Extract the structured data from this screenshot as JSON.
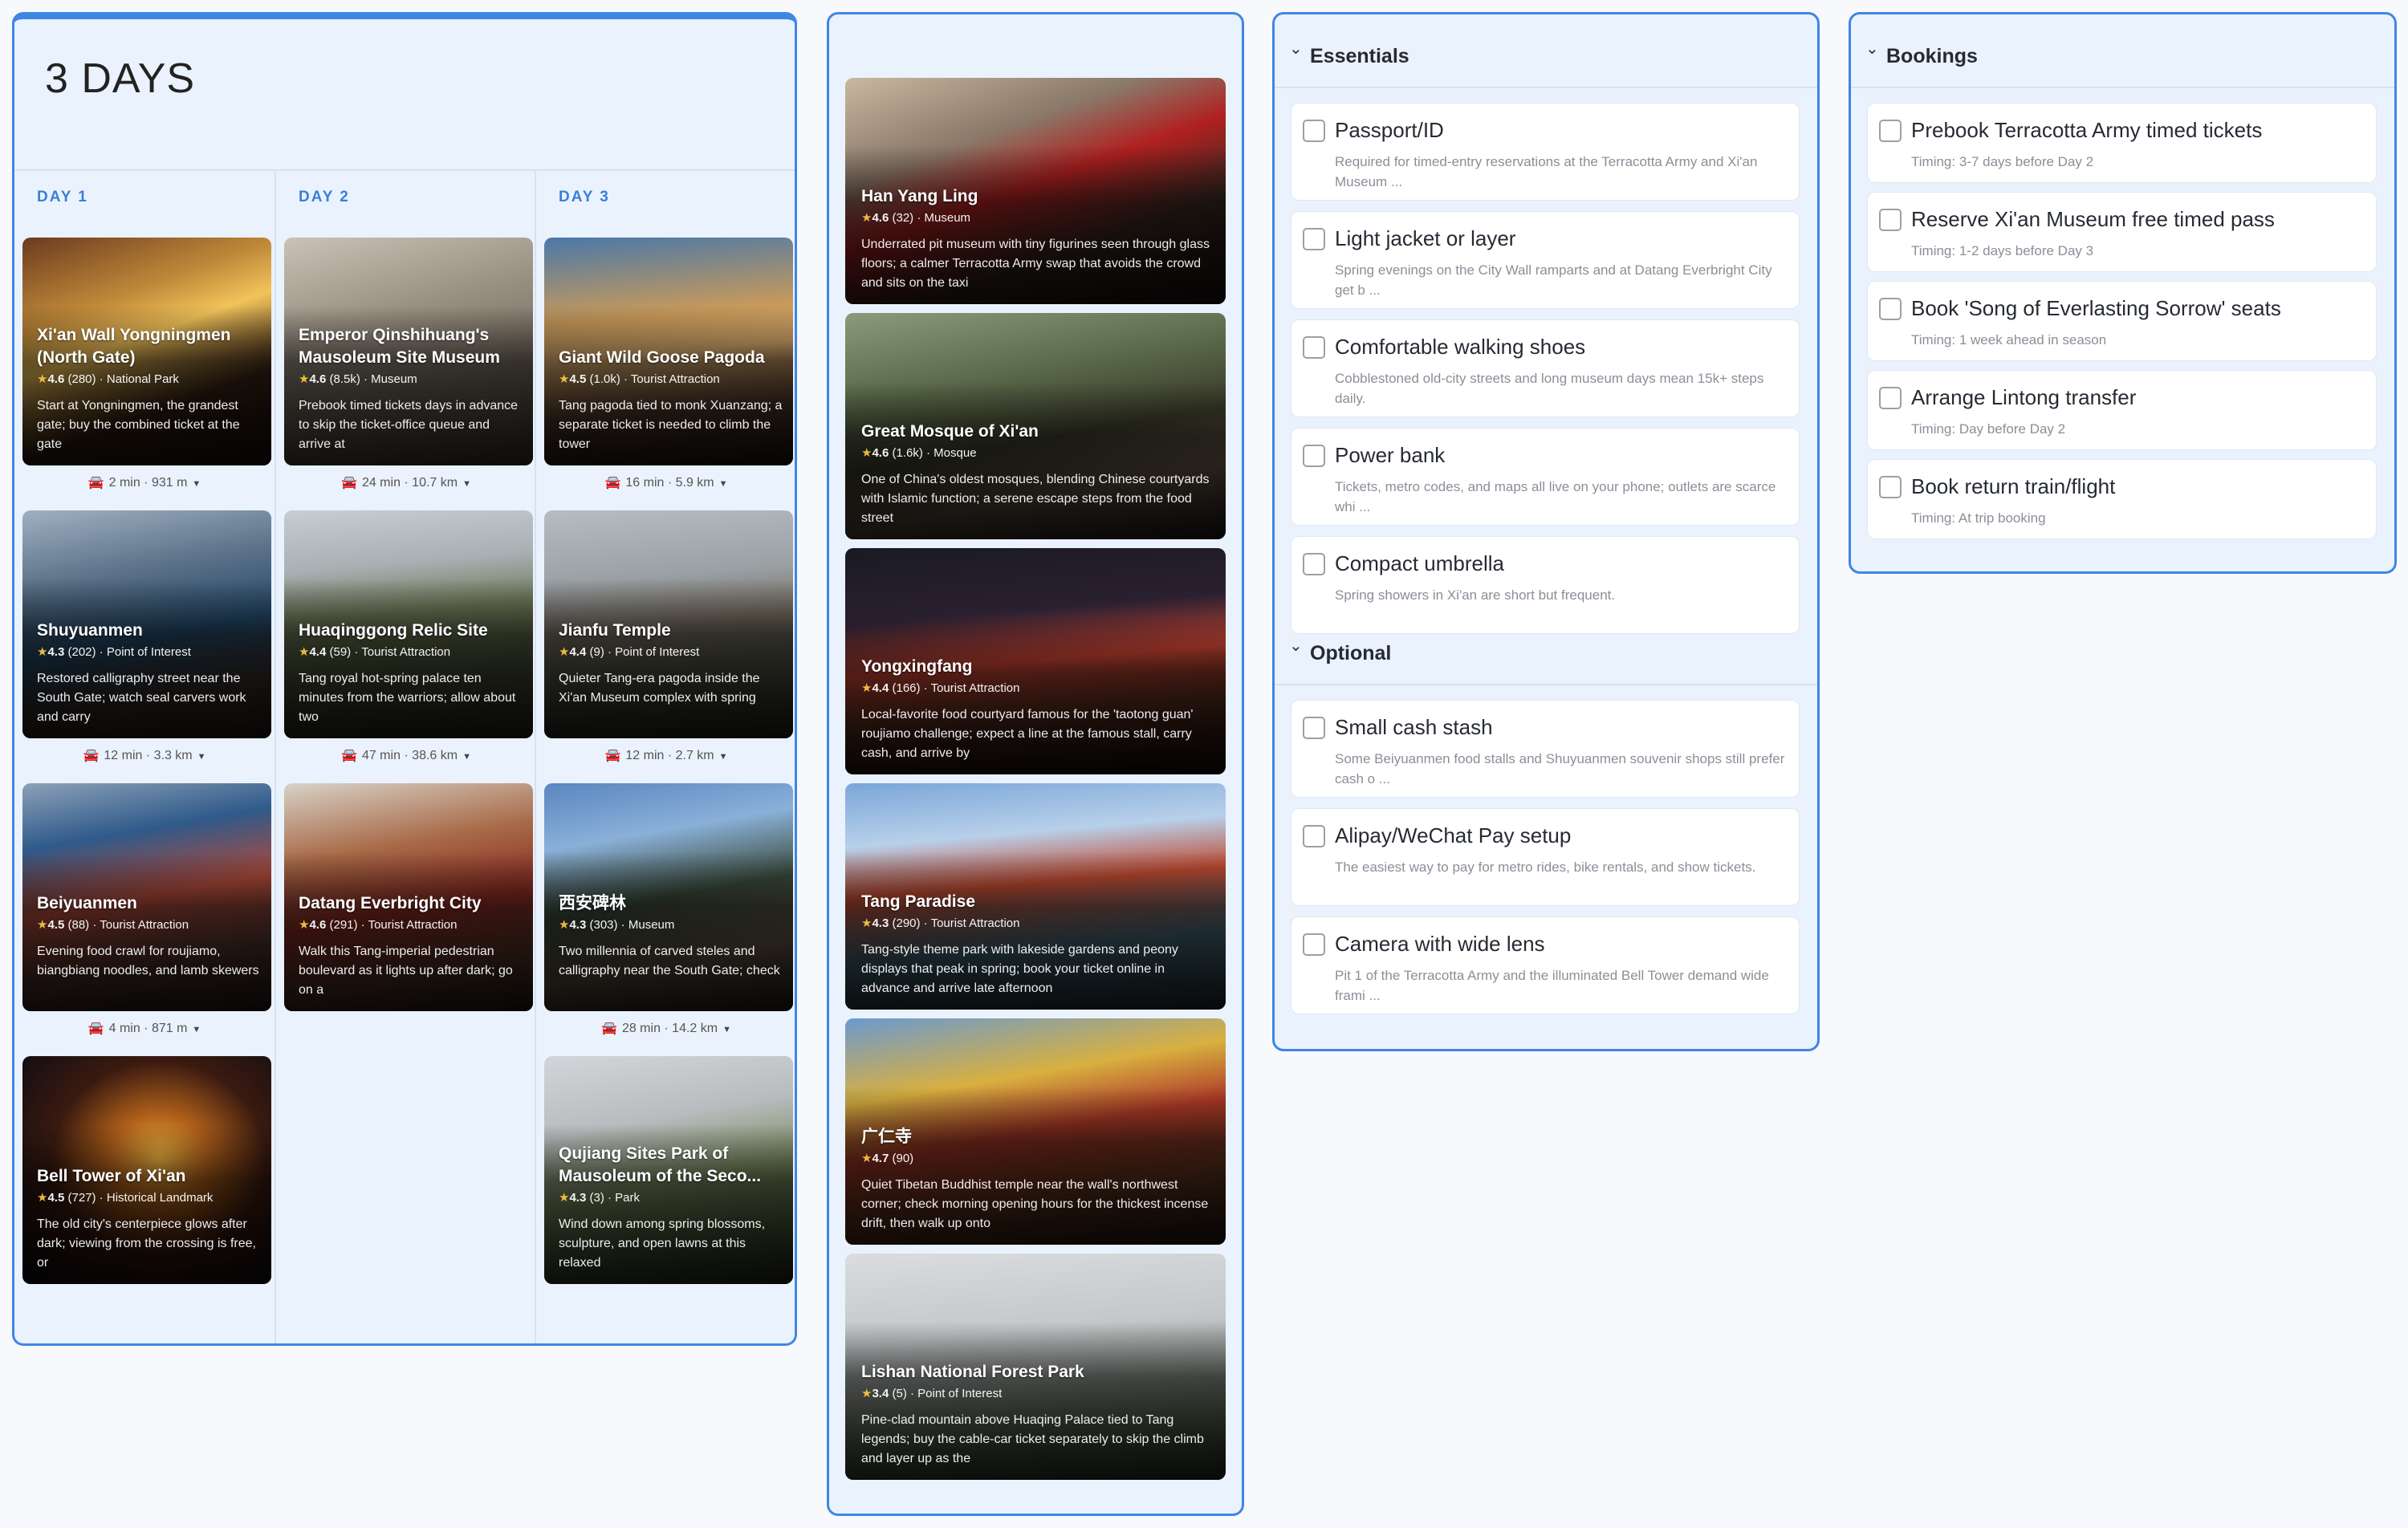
{
  "trip": {
    "title": "3 DAYS"
  },
  "days": [
    {
      "label": "DAY 1",
      "stops": [
        {
          "name": "Xi'an Wall Yongningmen (North Gate)",
          "rating": "4.6",
          "reviews": "(280)",
          "category": "National Park",
          "desc": "Start at Yongningmen, the grandest gate; buy the combined ticket at the gate",
          "bg": "linear-gradient(160deg,#6b3a1e 0%,#c08a3a 30%,#f2c35a 45%,#3b2414 70%,#1a0f08 100%)"
        },
        {
          "name": "Shuyuanmen",
          "rating": "4.3",
          "reviews": "(202)",
          "category": "Point of Interest",
          "desc": "Restored calligraphy street near the South Gate; watch seal carvers work and carry",
          "bg": "linear-gradient(170deg,#9fb0c2 0%,#5a7087 30%,#244a6a 55%,#403028 80%,#2a2018 100%)"
        },
        {
          "name": "Beiyuanmen",
          "rating": "4.5",
          "reviews": "(88)",
          "category": "Tourist Attraction",
          "desc": "Evening food crawl for roujiamo, biangbiang noodles, and lamb skewers",
          "bg": "linear-gradient(170deg,#8da1b8 0%,#2f5a8a 25%,#b04a3a 50%,#5a3a30 75%,#2a201c 100%)"
        },
        {
          "name": "Bell Tower of Xi'an",
          "rating": "4.5",
          "reviews": "(727)",
          "category": "Historical Landmark",
          "desc": "The old city's centerpiece glows after dark; viewing from the crossing is free, or",
          "bg": "radial-gradient(ellipse at 55% 45%,#f2b640 0%,#b0601a 25%,#3a1a10 55%,#0a0a12 100%)"
        }
      ],
      "travel": [
        "2 min · 931 m",
        "12 min · 3.3 km",
        "4 min · 871 m"
      ]
    },
    {
      "label": "DAY 2",
      "stops": [
        {
          "name": "Emperor Qinshihuang's Mausoleum Site Museum",
          "rating": "4.6",
          "reviews": "(8.5k)",
          "category": "Museum",
          "desc": "Prebook timed tickets days in advance to skip the ticket-office queue and arrive at",
          "bg": "linear-gradient(165deg,#c9c2b6 0%,#9a9082 35%,#7a7064 60%,#4a4238 100%)"
        },
        {
          "name": "Huaqinggong Relic Site",
          "rating": "4.4",
          "reviews": "(59)",
          "category": "Tourist Attraction",
          "desc": "Tang royal hot-spring palace ten minutes from the warriors; allow about two",
          "bg": "linear-gradient(175deg,#c6cdd3 0%,#a9b0b4 25%,#6f7a58 45%,#4a5238 70%,#2a2a20 100%)"
        },
        {
          "name": "Datang Everbright City",
          "rating": "4.6",
          "reviews": "(291)",
          "category": "Tourist Attraction",
          "desc": "Walk this Tang-imperial pedestrian boulevard as it lights up after dark; go on a",
          "bg": "linear-gradient(170deg,#d8d2c8 0%,#a86a48 30%,#8a2a22 55%,#5a3a2a 80%,#2a2018 100%)"
        }
      ],
      "travel": [
        "24 min · 10.7 km",
        "47 min · 38.6 km"
      ]
    },
    {
      "label": "DAY 3",
      "stops": [
        {
          "name": "Giant Wild Goose Pagoda",
          "rating": "4.5",
          "reviews": "(1.0k)",
          "category": "Tourist Attraction",
          "desc": "Tang pagoda tied to monk Xuanzang; a separate ticket is needed to climb the tower",
          "bg": "linear-gradient(175deg,#4a78a8 0%,#c89a5a 35%,#e0b070 50%,#5a4030 75%,#20160e 100%)"
        },
        {
          "name": "Jianfu Temple",
          "rating": "4.4",
          "reviews": "(9)",
          "category": "Point of Interest",
          "desc": "Quieter Tang-era pagoda inside the Xi'an Museum complex with spring",
          "bg": "linear-gradient(175deg,#b6bcc2 0%,#9aa0a4 30%,#7a7064 50%,#4a5040 75%,#2a2a24 100%)"
        },
        {
          "name": "西安碑林",
          "rating": "4.3",
          "reviews": "(303)",
          "category": "Museum",
          "desc": "Two millennia of carved steles and calligraphy near the South Gate; check",
          "bg": "linear-gradient(170deg,#5a86c0 0%,#8ab0d8 25%,#3a4a3a 50%,#6a5a4a 75%,#2a241e 100%)"
        },
        {
          "name": "Qujiang Sites Park of Mausoleum of the Seco...",
          "rating": "4.3",
          "reviews": "(3)",
          "category": "Park",
          "desc": "Wind down among spring blossoms, sculpture, and open lawns at this relaxed",
          "bg": "linear-gradient(170deg,#d2d6da 0%,#b8bcbe 30%,#7a8a60 55%,#4a5a38 80%,#2a3020 100%)"
        }
      ],
      "travel": [
        "16 min · 5.9 km",
        "12 min · 2.7 km",
        "28 min · 14.2 km"
      ]
    }
  ],
  "pool": [
    {
      "name": "Han Yang Ling",
      "rating": "4.6",
      "reviews": "(32)",
      "category": "Museum",
      "desc": "Underrated pit museum with tiny figurines seen through glass floors; a calmer Terracotta Army swap that avoids the crowd and sits on the taxi",
      "bg": "linear-gradient(160deg,#c8b8a0 0%,#8a7868 30%,#b02020 48%,#3a2a22 70%,#1a1210 100%)"
    },
    {
      "name": "Great Mosque of Xi'an",
      "rating": "4.6",
      "reviews": "(1.6k)",
      "category": "Mosque",
      "desc": "One of China's oldest mosques, blending Chinese courtyards with Islamic function; a serene escape steps from the food street",
      "bg": "linear-gradient(170deg,#8a9a7a 0%,#5a6a4a 30%,#3a3a2a 55%,#6a5a4a 75%,#2a2420 100%)"
    },
    {
      "name": "Yongxingfang",
      "rating": "4.4",
      "reviews": "(166)",
      "category": "Tourist Attraction",
      "desc": "Local-favorite food courtyard famous for the 'taotong guan' roujiamo challenge; expect a line at the famous stall, carry cash, and arrive by",
      "bg": "linear-gradient(175deg,#1a1a22 0%,#2a2030 30%,#c04030 50%,#603020 70%,#100c0c 100%)"
    },
    {
      "name": "Tang Paradise",
      "rating": "4.3",
      "reviews": "(290)",
      "category": "Tourist Attraction",
      "desc": "Tang-style theme park with lakeside gardens and peony displays that peak in spring; book your ticket online in advance and arrive late afternoon",
      "bg": "linear-gradient(175deg,#7aa6d8 0%,#b8d0ea 25%,#c04a30 45%,#4a7080 70%,#2a3a40 100%)"
    },
    {
      "name": "广仁寺",
      "rating": "4.7",
      "reviews": "(90)",
      "category": "",
      "desc": "Quiet Tibetan Buddhist temple near the wall's northwest corner; check morning opening hours for the thickest incense drift, then walk up onto",
      "bg": "linear-gradient(170deg,#6a9ad0 0%,#d8b040 30%,#b03a28 50%,#6a3a20 75%,#2a1c14 100%)"
    },
    {
      "name": "Lishan National Forest Park",
      "rating": "3.4",
      "reviews": "(5)",
      "category": "Point of Interest",
      "desc": "Pine-clad mountain above Huaqing Palace tied to Tang legends; buy the cable-car ticket separately to skip the climb and layer up as the",
      "bg": "linear-gradient(175deg,#dadcde 0%,#c4c8ca 35%,#9aa09a 55%,#5a6a50 80%,#303828 100%)"
    }
  ],
  "essentials": {
    "title": "Essentials",
    "items": [
      {
        "title": "Passport/ID",
        "note": "Required for timed-entry reservations at the Terracotta Army and Xi'an Museum ..."
      },
      {
        "title": "Light jacket or layer",
        "note": "Spring evenings on the City Wall ramparts and at Datang Everbright City get b ..."
      },
      {
        "title": "Comfortable walking shoes",
        "note": "Cobblestoned old-city streets and long museum days mean 15k+ steps daily."
      },
      {
        "title": "Power bank",
        "note": "Tickets, metro codes, and maps all live on your phone; outlets are scarce whi ..."
      },
      {
        "title": "Compact umbrella",
        "note": "Spring showers in Xi'an are short but frequent."
      }
    ]
  },
  "optional": {
    "title": "Optional",
    "items": [
      {
        "title": "Small cash stash",
        "note": "Some Beiyuanmen food stalls and Shuyuanmen souvenir shops still prefer cash o ..."
      },
      {
        "title": "Alipay/WeChat Pay setup",
        "note": "The easiest way to pay for metro rides, bike rentals, and show tickets."
      },
      {
        "title": "Camera with wide lens",
        "note": "Pit 1 of the Terracotta Army and the illuminated Bell Tower demand wide frami ..."
      }
    ]
  },
  "bookings": {
    "title": "Bookings",
    "items": [
      {
        "title": "Prebook Terracotta Army timed tickets",
        "note": "Timing: 3-7 days before Day 2"
      },
      {
        "title": "Reserve Xi'an Museum free timed pass",
        "note": "Timing: 1-2 days before Day 3"
      },
      {
        "title": "Book 'Song of Everlasting Sorrow' seats",
        "note": "Timing: 1 week ahead in season"
      },
      {
        "title": "Arrange Lintong transfer",
        "note": "Timing: Day before Day 2"
      },
      {
        "title": "Book return train/flight",
        "note": "Timing: At trip booking"
      }
    ]
  },
  "icons": {
    "star": "star-icon",
    "car": "car-icon",
    "caret": "caret-down-icon",
    "chevron": "chevron-down-icon"
  },
  "colors": {
    "accent": "#3f86e5",
    "panel_bg": "#eaf2fd",
    "star": "#f6c343"
  }
}
